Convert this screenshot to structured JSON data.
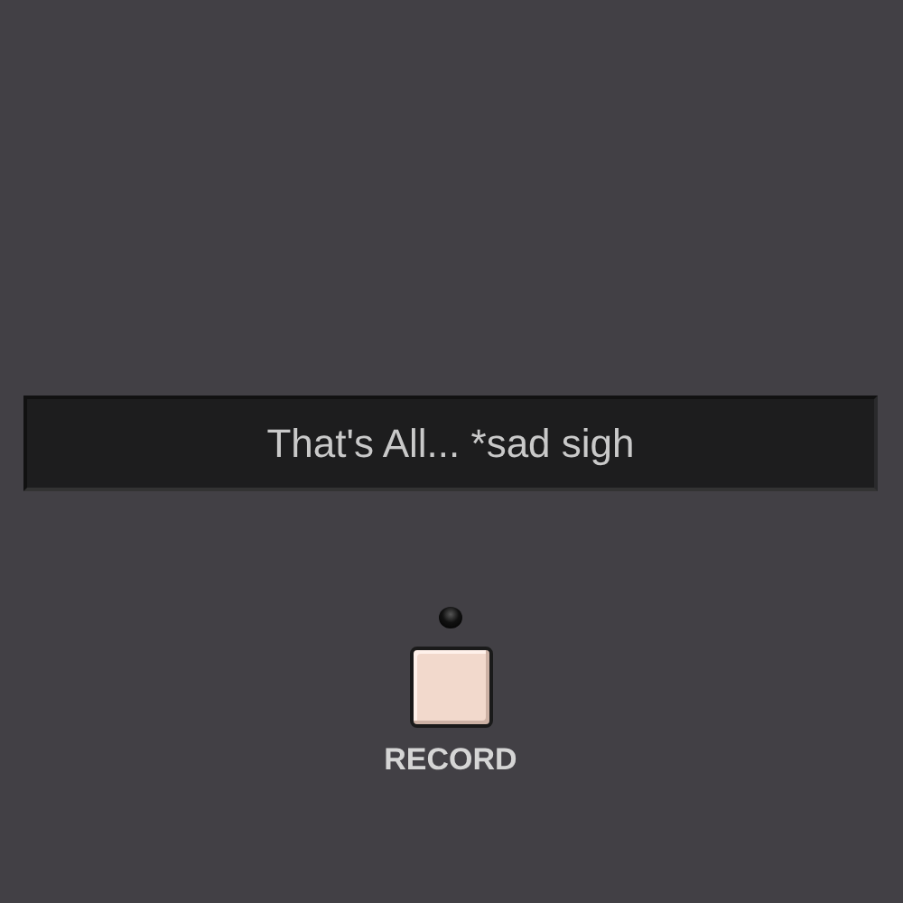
{
  "display": {
    "text": "That's All... *sad sigh"
  },
  "record": {
    "label": "RECORD",
    "recording": false
  }
}
